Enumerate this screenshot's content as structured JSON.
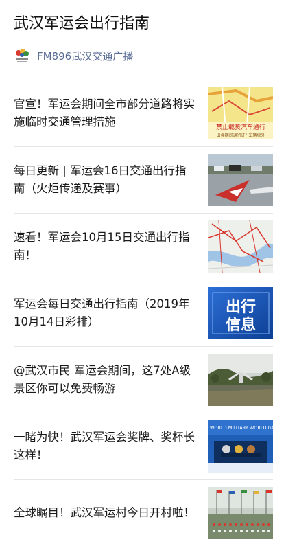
{
  "page": {
    "title": "武汉军运会出行指南"
  },
  "account": {
    "name": "FM896武汉交通广播",
    "logo_icon": "fm896-logo-icon"
  },
  "articles": [
    {
      "title": "官宣！军运会期间全市部分道路将实施临时交通管理措施",
      "thumb_caption_1": "禁止载货汽车通行",
      "thumb_caption_2": "出会期间通行证\" 车辆除外",
      "thumb_icon": "traffic-map-thumbnail"
    },
    {
      "title": "每日更新 | 军运会16日交通出行指南（火炬传递及赛事）",
      "thumb_icon": "road-marking-photo-thumbnail"
    },
    {
      "title": "速看！军运会10月15日交通出行指南！",
      "thumb_icon": "route-map-thumbnail"
    },
    {
      "title": "军运会每日交通出行指南（2019年10月14日彩排）",
      "thumb_text_1": "出行",
      "thumb_text_2": "信息",
      "thumb_icon": "travel-info-thumbnail"
    },
    {
      "title": "@武汉市民 军运会期间，这7处A级景区你可以免费畅游",
      "thumb_icon": "scenic-area-photo-thumbnail"
    },
    {
      "title": "一睹为快！武汉军运会奖牌、奖杯长这样！",
      "thumb_banner": "WORLD MILITARY WORLD GAMES PRESS CO",
      "thumb_icon": "medals-photo-thumbnail"
    },
    {
      "title": "全球瞩目！武汉军运村今日开村啦！",
      "thumb_icon": "athletes-village-photo-thumbnail"
    }
  ],
  "colors": {
    "link": "#576b95",
    "divider": "#e5e5e5"
  }
}
